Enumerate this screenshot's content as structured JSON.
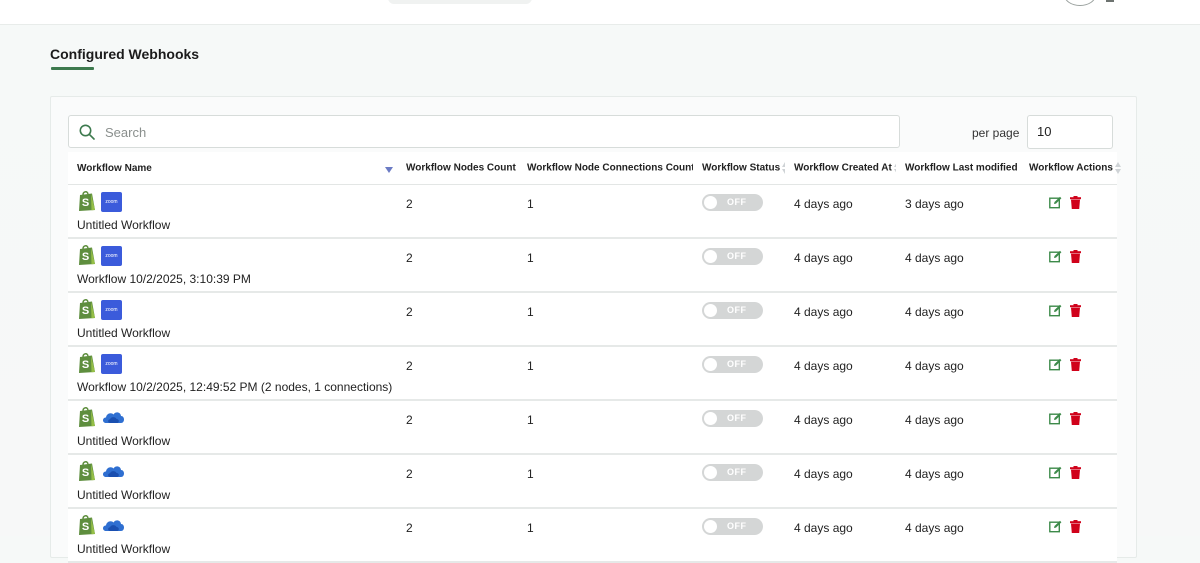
{
  "section": {
    "title": "Configured Webhooks"
  },
  "search": {
    "placeholder": "Search"
  },
  "pagination": {
    "per_page_label": "per page",
    "per_page_value": "10"
  },
  "table": {
    "columns": [
      "Workflow Name",
      "Workflow Nodes Count",
      "Workflow Node Connections Count",
      "Workflow Status",
      "Workflow Created At",
      "Workflow Last modified",
      "Workflow Actions"
    ],
    "rows": [
      {
        "icons": [
          "shopify-icon",
          "zoom-icon"
        ],
        "zoom_text": "zoom",
        "name": "Untitled Workflow",
        "nodes": "2",
        "connections": "1",
        "status": "OFF",
        "created": "4 days ago",
        "modified": "3 days ago"
      },
      {
        "icons": [
          "shopify-icon",
          "zoom-icon"
        ],
        "zoom_text": "zoom",
        "name": "Workflow 10/2/2025, 3:10:39 PM",
        "nodes": "2",
        "connections": "1",
        "status": "OFF",
        "created": "4 days ago",
        "modified": "4 days ago"
      },
      {
        "icons": [
          "shopify-icon",
          "zoom-icon"
        ],
        "zoom_text": "zoom",
        "name": "Untitled Workflow",
        "nodes": "2",
        "connections": "1",
        "status": "OFF",
        "created": "4 days ago",
        "modified": "4 days ago"
      },
      {
        "icons": [
          "shopify-icon",
          "zoom-icon"
        ],
        "zoom_text": "zoom",
        "name": "Workflow 10/2/2025, 12:49:52 PM (2 nodes, 1 connections)",
        "nodes": "2",
        "connections": "1",
        "status": "OFF",
        "created": "4 days ago",
        "modified": "4 days ago"
      },
      {
        "icons": [
          "shopify-icon",
          "onedrive-icon"
        ],
        "name": "Untitled Workflow",
        "nodes": "2",
        "connections": "1",
        "status": "OFF",
        "created": "4 days ago",
        "modified": "4 days ago"
      },
      {
        "icons": [
          "shopify-icon",
          "onedrive-icon"
        ],
        "name": "Untitled Workflow",
        "nodes": "2",
        "connections": "1",
        "status": "OFF",
        "created": "4 days ago",
        "modified": "4 days ago"
      },
      {
        "icons": [
          "shopify-icon",
          "onedrive-icon"
        ],
        "name": "Untitled Workflow",
        "nodes": "2",
        "connections": "1",
        "status": "OFF",
        "created": "4 days ago",
        "modified": "4 days ago"
      }
    ]
  },
  "colors": {
    "accent": "#3d7a4e",
    "zoom": "#3b5bdb",
    "edit": "#3d8a4a",
    "delete": "#d0021b",
    "toggle_off": "#d4d6d6"
  }
}
